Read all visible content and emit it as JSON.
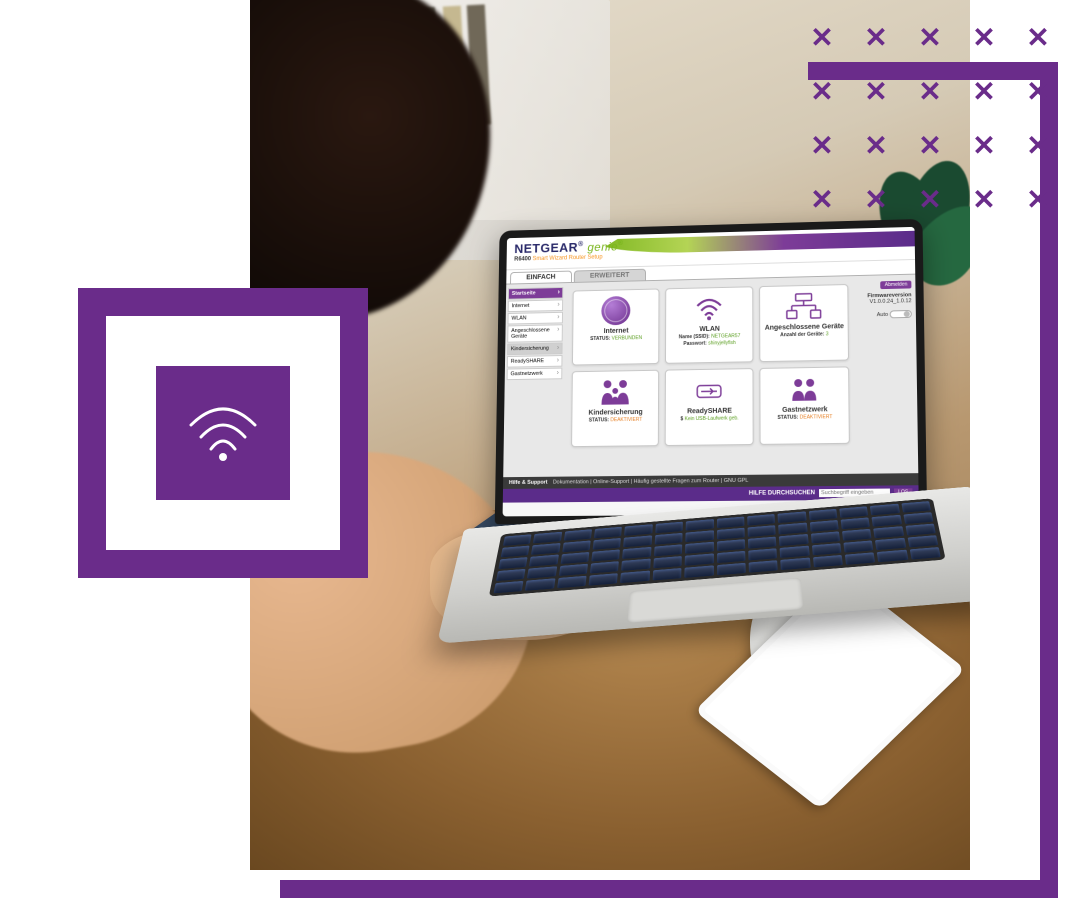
{
  "brand": {
    "name": "NETGEAR",
    "sub": "genie",
    "model_prefix": "R6400",
    "model_desc": "Smart Wizard Router Setup"
  },
  "tabs": {
    "simple": "EINFACH",
    "advanced": "ERWEITERT"
  },
  "sidebar": {
    "items": [
      "Startseite",
      "Internet",
      "WLAN",
      "Angeschlossene Geräte",
      "Kindersicherung",
      "ReadySHARE",
      "Gastnetzwerk"
    ]
  },
  "tiles": {
    "internet": {
      "title": "Internet",
      "status_label": "STATUS:",
      "status_value": "VERBUNDEN"
    },
    "wlan": {
      "title": "WLAN",
      "ssid_label": "Name (SSID):",
      "ssid_value": "NETGEAR57",
      "pw_label": "Passwort:",
      "pw_value": "shinyjellyfish"
    },
    "devices": {
      "title": "Angeschlossene Geräte",
      "count_label": "Anzahl der Geräte:",
      "count_value": "3"
    },
    "parental": {
      "title": "Kindersicherung",
      "status_label": "STATUS:",
      "status_value": "DEAKTIVIERT"
    },
    "readyshare": {
      "title": "ReadySHARE",
      "status_label": "Kein USB-Laufwerk geb."
    },
    "guest": {
      "title": "Gastnetzwerk",
      "status_label": "STATUS:",
      "status_value": "DEAKTIVIERT"
    }
  },
  "right": {
    "logout": "Abmelden",
    "fw_label": "Firmwareversion",
    "fw_value": "V1.0.0.24_1.0.12",
    "auto": "Auto"
  },
  "footer": {
    "help_title": "Hilfe & Support",
    "links": "Dokumentation | Online-Support | Häufig gestellte Fragen zum Router | GNU GPL",
    "search_label": "HILFE DURCHSUCHEN",
    "search_placeholder": "Suchbegriff eingeben",
    "go": "LOS"
  }
}
